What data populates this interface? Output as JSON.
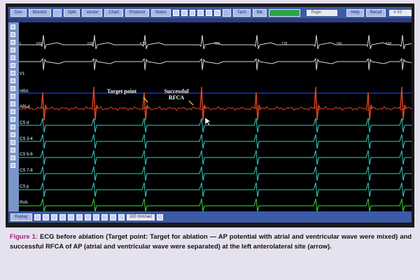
{
  "toolbar": {
    "buttons": [
      "Dev",
      "Monitor",
      "",
      "Split",
      "Vector",
      "Chart",
      "Protocol",
      "Notes"
    ],
    "extra_buttons": [
      "",
      "Tach",
      "Blk"
    ],
    "record_button": "",
    "field1": "Page: 15:37",
    "help_button": "Help",
    "recall_button": "Recall",
    "counter": "4 93 19"
  },
  "info_strip": "",
  "channels": [
    "I",
    "V1",
    "HRA",
    "ABLd",
    "CS d",
    "CS 3-4",
    "CS 5-6",
    "CS 7-8",
    "CS p",
    "RVA"
  ],
  "rr_intervals": [
    "639",
    "638",
    "679",
    "666",
    "778",
    "745",
    "698"
  ],
  "annotations": {
    "target": "Target point",
    "success": "Successful RFCA"
  },
  "speed": "100 mm/sec",
  "replay": "Replay",
  "caption": {
    "figure_label": "Figure 1:",
    "text": "ECG before ablation (Target point: Target for ablation — AP potential with atrial and ventricular wave were mixed) and successful RFCA of AP (atrial and ventricular wave were separated) at the left anterolateral site (arrow)."
  },
  "colors": {
    "background": "#e6e1ee",
    "toolbar": "#3c5aa8",
    "ecg_trace": "#d9d9d9",
    "hra_line": "#1f3de0",
    "abl_trace": "#e2431f",
    "cs_trace": "#35d0c8",
    "rva_trace": "#3ddc3d",
    "annotation_arrow": "#f3e646",
    "figure_label": "#9b2a73"
  }
}
